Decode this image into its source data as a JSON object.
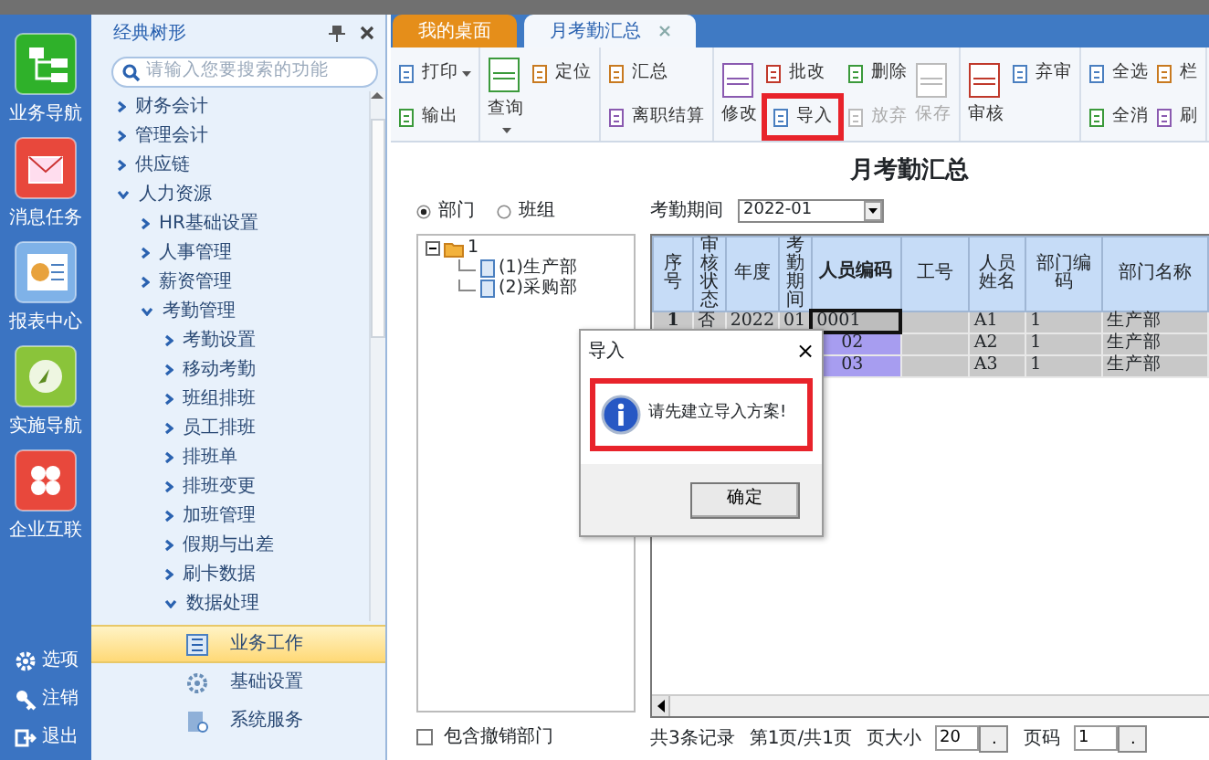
{
  "rail": {
    "items": [
      {
        "label": "业务导航",
        "kind": "tree"
      },
      {
        "label": "消息任务",
        "kind": "mail"
      },
      {
        "label": "报表中心",
        "kind": "report"
      },
      {
        "label": "实施导航",
        "kind": "compass"
      },
      {
        "label": "企业互联",
        "kind": "link"
      }
    ],
    "bottom": [
      {
        "label": "选项",
        "kind": "gear"
      },
      {
        "label": "注销",
        "kind": "key"
      },
      {
        "label": "退出",
        "kind": "exit"
      }
    ]
  },
  "nav": {
    "title": "经典树形",
    "search_placeholder": "请输入您要搜索的功能",
    "tree": [
      {
        "label": "财务会计",
        "expanded": false
      },
      {
        "label": "管理会计",
        "expanded": false
      },
      {
        "label": "供应链",
        "expanded": false
      },
      {
        "label": "人力资源",
        "expanded": true,
        "children": [
          {
            "label": "HR基础设置",
            "expanded": false
          },
          {
            "label": "人事管理",
            "expanded": false
          },
          {
            "label": "薪资管理",
            "expanded": false
          },
          {
            "label": "考勤管理",
            "expanded": true,
            "children": [
              {
                "label": "考勤设置",
                "expanded": false
              },
              {
                "label": "移动考勤",
                "expanded": false
              },
              {
                "label": "班组排班",
                "expanded": false
              },
              {
                "label": "员工排班",
                "expanded": false
              },
              {
                "label": "排班单",
                "expanded": false
              },
              {
                "label": "排班变更",
                "expanded": false
              },
              {
                "label": "加班管理",
                "expanded": false
              },
              {
                "label": "假期与出差",
                "expanded": false
              },
              {
                "label": "刷卡数据",
                "expanded": false
              },
              {
                "label": "数据处理",
                "expanded": true
              }
            ]
          }
        ]
      }
    ],
    "sections": [
      {
        "label": "业务工作",
        "selected": true,
        "kind": "work"
      },
      {
        "label": "基础设置",
        "selected": false,
        "kind": "gear"
      },
      {
        "label": "系统服务",
        "selected": false,
        "kind": "server"
      }
    ]
  },
  "tabs": [
    {
      "label": "我的桌面",
      "selected": false
    },
    {
      "label": "月考勤汇总",
      "selected": true,
      "closable": true
    }
  ],
  "toolbar": [
    {
      "items": [
        {
          "label": "打印",
          "kind": "small",
          "caret": true
        },
        {
          "label": "输出",
          "kind": "small"
        }
      ]
    },
    {
      "items": [
        {
          "label": "查询",
          "kind": "large",
          "caret": true
        },
        {
          "label": "定位",
          "kind": "small"
        }
      ]
    },
    {
      "items": [
        {
          "label": "汇总",
          "kind": "small"
        },
        {
          "label": "离职结算",
          "kind": "small"
        }
      ]
    },
    {
      "items": [
        {
          "label": "修改",
          "kind": "large"
        },
        {
          "label": "批改",
          "kind": "small"
        },
        {
          "label": "导入",
          "kind": "small",
          "highlighted": true
        },
        {
          "label": "删除",
          "kind": "small"
        },
        {
          "label": "放弃",
          "kind": "small",
          "disabled": true
        },
        {
          "label": "保存",
          "kind": "large",
          "disabled": true
        }
      ]
    },
    {
      "items": [
        {
          "label": "审核",
          "kind": "large"
        },
        {
          "label": "弃审",
          "kind": "small"
        }
      ]
    },
    {
      "items": [
        {
          "label": "全选",
          "kind": "small"
        },
        {
          "label": "全消",
          "kind": "small"
        },
        {
          "label": "栏",
          "kind": "small"
        },
        {
          "label": "刷",
          "kind": "small"
        }
      ]
    }
  ],
  "page_title": "月考勤汇总",
  "filter": {
    "options": [
      {
        "label": "部门",
        "selected": true
      },
      {
        "label": "班组",
        "selected": false
      }
    ],
    "org_tree": [
      {
        "label": "1",
        "expanded": true,
        "children": [
          {
            "label": "(1)生产部"
          },
          {
            "label": "(2)采购部"
          }
        ]
      }
    ],
    "include_revoked": {
      "label": "包含撤销部门",
      "checked": false
    }
  },
  "period": {
    "label": "考勤期间",
    "value": "2022-01"
  },
  "table": {
    "columns": [
      "序号",
      "审核状态",
      "年度",
      "考勤期间",
      "人员编码",
      "工号",
      "人员姓名",
      "部门编码",
      "部门名称"
    ],
    "rows": [
      {
        "selected": false,
        "current": true,
        "cells": [
          "1",
          "否",
          "2022",
          "01",
          "0001",
          null,
          "A1",
          "1",
          "生产部"
        ]
      },
      {
        "selected": true,
        "current": false,
        "cells": [
          null,
          null,
          null,
          null,
          "02",
          null,
          "A2",
          "1",
          "生产部"
        ]
      },
      {
        "selected": true,
        "current": false,
        "cells": [
          null,
          null,
          null,
          null,
          "03",
          null,
          "A3",
          "1",
          "生产部"
        ]
      }
    ]
  },
  "footer": {
    "records": "共3条记录",
    "pages": "第1页/共1页",
    "page_size_label": "页大小",
    "page_size": "20",
    "page_size_button": ".",
    "page_no_label": "页码",
    "page_no": "1",
    "page_no_button": "."
  },
  "dialog": {
    "title": "导入",
    "close": "×",
    "message": "请先建立导入方案!",
    "message_highlighted": true,
    "button": "确定"
  }
}
